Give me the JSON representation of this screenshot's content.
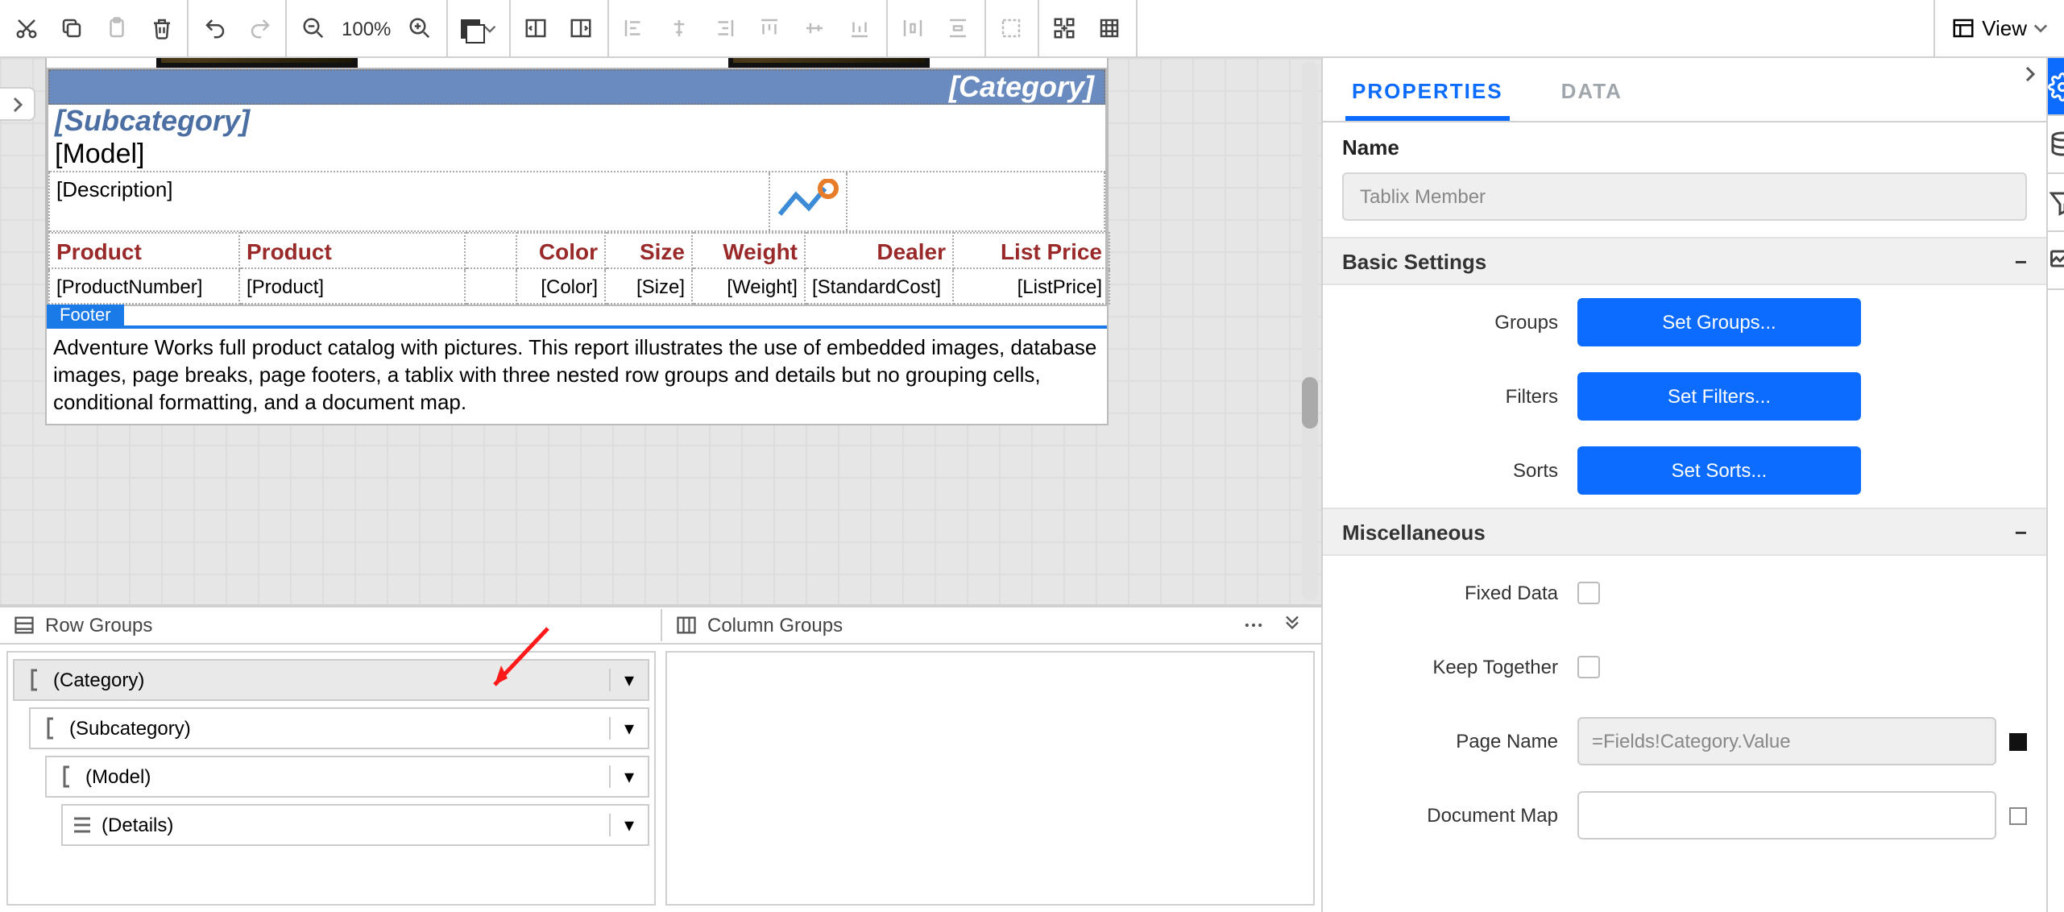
{
  "toolbar": {
    "zoom_pct": "100%",
    "view_label": "View"
  },
  "designer": {
    "category_placeholder": "[Category]",
    "subcategory_placeholder": "[Subcategory]",
    "model_placeholder": "[Model]",
    "description_placeholder": "[Description]",
    "columns": [
      {
        "header": "Product",
        "cell": "[ProductNumber]"
      },
      {
        "header": "Product",
        "cell": "[Product]"
      },
      {
        "header": "",
        "cell": ""
      },
      {
        "header": "Color",
        "cell": "[Color]"
      },
      {
        "header": "Size",
        "cell": "[Size]"
      },
      {
        "header": "Weight",
        "cell": "[Weight]"
      },
      {
        "header": "Dealer",
        "cell": "[StandardCost]"
      },
      {
        "header": "List Price",
        "cell": "[ListPrice]"
      }
    ],
    "footer_tag": "Footer",
    "footer_text": "Adventure Works full product catalog with pictures. This report illustrates the use of embedded images, database images, page breaks, page footers, a tablix with three nested row groups and details but no grouping cells, conditional formatting, and a document map."
  },
  "groups_panel": {
    "row_heading": "Row Groups",
    "col_heading": "Column Groups",
    "rows": [
      {
        "label": "(Category)",
        "indent": 0,
        "selected": true
      },
      {
        "label": "(Subcategory)",
        "indent": 1,
        "selected": false
      },
      {
        "label": "(Model)",
        "indent": 2,
        "selected": false
      },
      {
        "label": "(Details)",
        "indent": 3,
        "selected": false,
        "details": true
      }
    ]
  },
  "properties": {
    "tabs": {
      "properties": "PROPERTIES",
      "data": "DATA"
    },
    "name_label": "Name",
    "name_value": "Tablix Member",
    "basic_settings_label": "Basic Settings",
    "rows": {
      "groups": {
        "lbl": "Groups",
        "btn": "Set Groups..."
      },
      "filters": {
        "lbl": "Filters",
        "btn": "Set Filters..."
      },
      "sorts": {
        "lbl": "Sorts",
        "btn": "Set Sorts..."
      }
    },
    "misc_label": "Miscellaneous",
    "misc": {
      "fixed_data": "Fixed Data",
      "keep_together": "Keep Together",
      "page_name_label": "Page Name",
      "page_name_value": "=Fields!Category.Value",
      "document_map_label": "Document Map",
      "document_map_value": ""
    }
  }
}
